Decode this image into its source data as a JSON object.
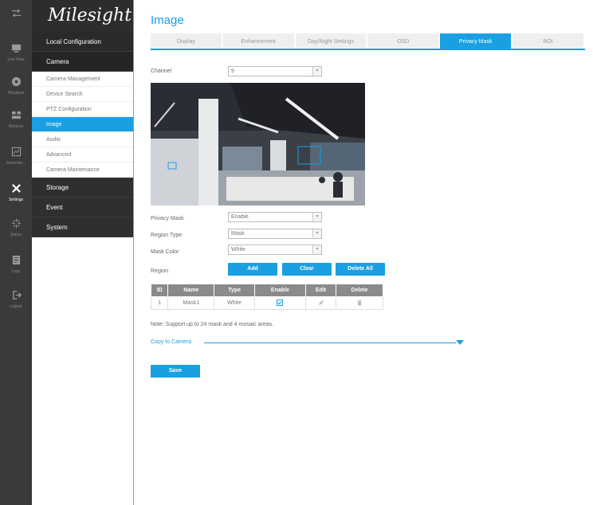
{
  "rail": {
    "items": [
      {
        "label": "",
        "icon": "menu-icon"
      },
      {
        "label": "Live View",
        "icon": "monitor-icon"
      },
      {
        "label": "Playback",
        "icon": "playback-icon"
      },
      {
        "label": "Retrieve",
        "icon": "retrieve-icon"
      },
      {
        "label": "Smart An...",
        "icon": "smart-analysis-icon"
      },
      {
        "label": "Settings",
        "icon": "settings-icon"
      },
      {
        "label": "Status",
        "icon": "status-icon"
      },
      {
        "label": "Logs",
        "icon": "logs-icon"
      },
      {
        "label": "Logout",
        "icon": "logout-icon"
      }
    ]
  },
  "sidebar": {
    "brand": "Milesight",
    "local_configuration": "Local Configuration",
    "camera": "Camera",
    "camera_items": [
      "Camera Management",
      "Device Search",
      "PTZ Configuration",
      "Image",
      "Audio",
      "Advanced",
      "Camera Maintenance"
    ],
    "storage": "Storage",
    "event": "Event",
    "system": "System"
  },
  "main": {
    "title": "Image",
    "tabs": [
      "Display",
      "Enhancement",
      "Day/Night Settings",
      "OSD",
      "Privacy Mask",
      "ROI"
    ],
    "active_tab": "Privacy Mask",
    "channel_label": "Channel",
    "channel_value": "9",
    "privacy_mask_label": "Privacy Mask",
    "privacy_mask_value": "Enable",
    "region_type_label": "Region Type",
    "region_type_value": "Mask",
    "mask_color_label": "Mask Color",
    "mask_color_value": "White",
    "region_label": "Region",
    "add_label": "Add",
    "clear_label": "Clear",
    "delete_all_label": "Delete All",
    "table": {
      "headers": [
        "ID",
        "Name",
        "Type",
        "Enable",
        "Edit",
        "Delete"
      ],
      "rows": [
        [
          "1",
          "Mask1",
          "White",
          "",
          "",
          ""
        ]
      ]
    },
    "note": "Note: Support up to 24 mask and 4 mosaic areas.",
    "copy_to_camera": "Copy to Camera",
    "save_label": "Save"
  },
  "colors": {
    "accent": "#1a9fe3",
    "dark": "#2f2f2f",
    "rail": "#3a3a3a"
  }
}
